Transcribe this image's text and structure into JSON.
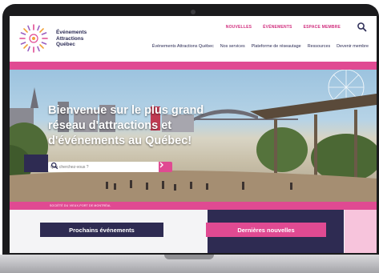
{
  "brand": {
    "line1": "Événements",
    "line2": "Attractions",
    "line3": "Québec",
    "pink": "#e04a92",
    "navy": "#2e2b52"
  },
  "top_links": [
    "NOUVELLES",
    "ÉVÉNEMENTS",
    "ESPACE MEMBRE"
  ],
  "nav": [
    "Événements Attractions Québec",
    "Nos services",
    "Plateforme de réseautage",
    "Ressources",
    "Devenir membre"
  ],
  "hero": {
    "title": "Bienvenue sur le plus grand réseau d'attractions et d'événements au Québec!",
    "search_placeholder": "Que cherchez-vous ?"
  },
  "strip_text": "SOCIÉTÉ DU VIEUX-PORT DE MONTRÉAL",
  "sections": {
    "events_label": "Prochains événements",
    "news_label": "Dernières nouvelles"
  },
  "icons": {
    "search": "search-icon",
    "logo": "sunburst-logo-icon"
  }
}
